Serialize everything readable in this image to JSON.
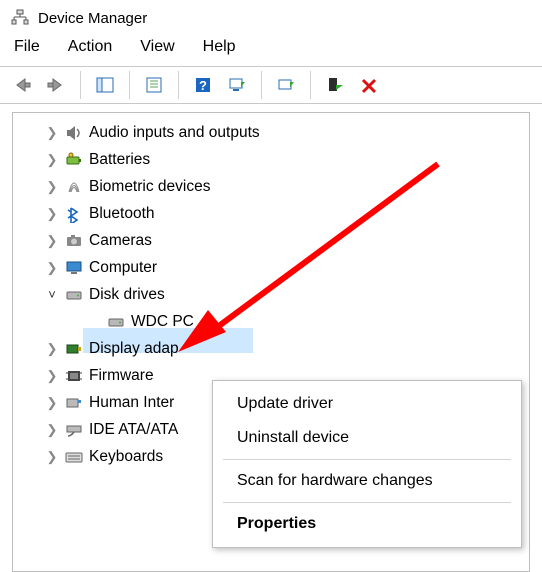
{
  "window": {
    "title": "Device Manager"
  },
  "menu": {
    "file": "File",
    "action": "Action",
    "view": "View",
    "help": "Help"
  },
  "toolbar": {
    "back": "Back",
    "forward": "Forward",
    "show_hide_tree": "Show/Hide console tree",
    "properties": "Properties",
    "help": "Help",
    "scan": "Scan for hardware changes",
    "update": "Update device drivers",
    "enable": "Enable device",
    "disable": "Disable device"
  },
  "tree": {
    "items": [
      {
        "label": "Audio inputs and outputs",
        "icon": "speaker-icon",
        "expanded": false
      },
      {
        "label": "Batteries",
        "icon": "battery-icon",
        "expanded": false
      },
      {
        "label": "Biometric devices",
        "icon": "fingerprint-icon",
        "expanded": false
      },
      {
        "label": "Bluetooth",
        "icon": "bluetooth-icon",
        "expanded": false
      },
      {
        "label": "Cameras",
        "icon": "camera-icon",
        "expanded": false
      },
      {
        "label": "Computer",
        "icon": "monitor-icon",
        "expanded": false
      },
      {
        "label": "Disk drives",
        "icon": "drive-icon",
        "expanded": true,
        "children": [
          {
            "label": "WDC PC",
            "icon": "drive-icon",
            "selected": true
          }
        ]
      },
      {
        "label": "Display adap",
        "icon": "display-adapter-icon",
        "expanded": false
      },
      {
        "label": "Firmware",
        "icon": "firmware-icon",
        "expanded": false
      },
      {
        "label": "Human Inter",
        "icon": "hid-icon",
        "expanded": false
      },
      {
        "label": "IDE ATA/ATA",
        "icon": "ide-icon",
        "expanded": false
      },
      {
        "label": "Keyboards",
        "icon": "keyboard-icon",
        "expanded": false
      }
    ]
  },
  "context_menu": {
    "update": "Update driver",
    "uninstall": "Uninstall device",
    "scan": "Scan for hardware changes",
    "props": "Properties"
  }
}
